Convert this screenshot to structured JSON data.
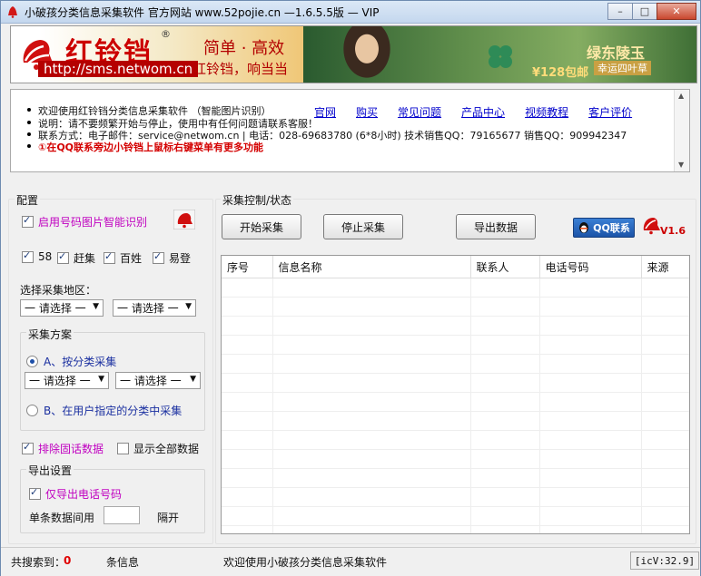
{
  "window": {
    "title": "小破孩分类信息采集软件 官方网站 www.52pojie.cn  —1.6.5.5版  — VIP",
    "minimize": "–",
    "maximize": "□",
    "close": "✕"
  },
  "banner": {
    "brand": "红铃铛",
    "reg": "®",
    "url": "http://sms.netwom.cn",
    "slogan1": "简单 · 高效",
    "slogan2": "红铃铛，响当当",
    "ad_title": "绿东陵玉",
    "ad_sub": "幸运四叶草",
    "ad_price": "¥128包邮"
  },
  "info": {
    "lines": [
      "欢迎使用红铃铛分类信息采集软件 （智能图片识别）",
      "说明：请不要频繁开始与停止，使用中有任何问题请联系客服！",
      "联系方式：电子邮件：service@netwom.cn | 电话：028-69683780 (6*8小时) 技术销售QQ：79165677 销售QQ：909942347",
      "①在QQ联系旁边小铃铛上鼠标右键菜单有更多功能"
    ],
    "links": [
      "官网",
      "购买",
      "常见问题",
      "产品中心",
      "视频教程",
      "客户评价"
    ]
  },
  "config": {
    "title": "配置",
    "smart_ocr": "启用号码图片智能识别",
    "sources": [
      "58",
      "赶集",
      "百姓",
      "易登"
    ],
    "region_label": "选择采集地区：",
    "region_sel1": "一 请选择 一",
    "region_sel2": "一 请选择 一",
    "scheme_title": "采集方案",
    "scheme_a": "A、按分类采集",
    "scheme_a_sel1": "一 请选择 一",
    "scheme_a_sel2": "一 请选择 一",
    "scheme_b": "B、在用户指定的分类中采集",
    "exclude_landline": "排除固话数据",
    "show_all": "显示全部数据",
    "export_title": "导出设置",
    "export_phone_only": "仅导出电话号码",
    "interval_label": "单条数据间用",
    "interval_value": "",
    "interval_suffix": "隔开"
  },
  "control": {
    "title": "采集控制/状态",
    "start": "开始采集",
    "stop": "停止采集",
    "export": "导出数据",
    "qq": "QQ联系",
    "version": "V1.6"
  },
  "table": {
    "columns": [
      "序号",
      "信息名称",
      "联系人",
      "电话号码",
      "来源"
    ],
    "rows": []
  },
  "status": {
    "found_label": "共搜索到：",
    "found_count": "0",
    "unit": "条信息",
    "message": "欢迎使用小破孩分类信息采集软件",
    "code": "[icV:32.9]"
  }
}
